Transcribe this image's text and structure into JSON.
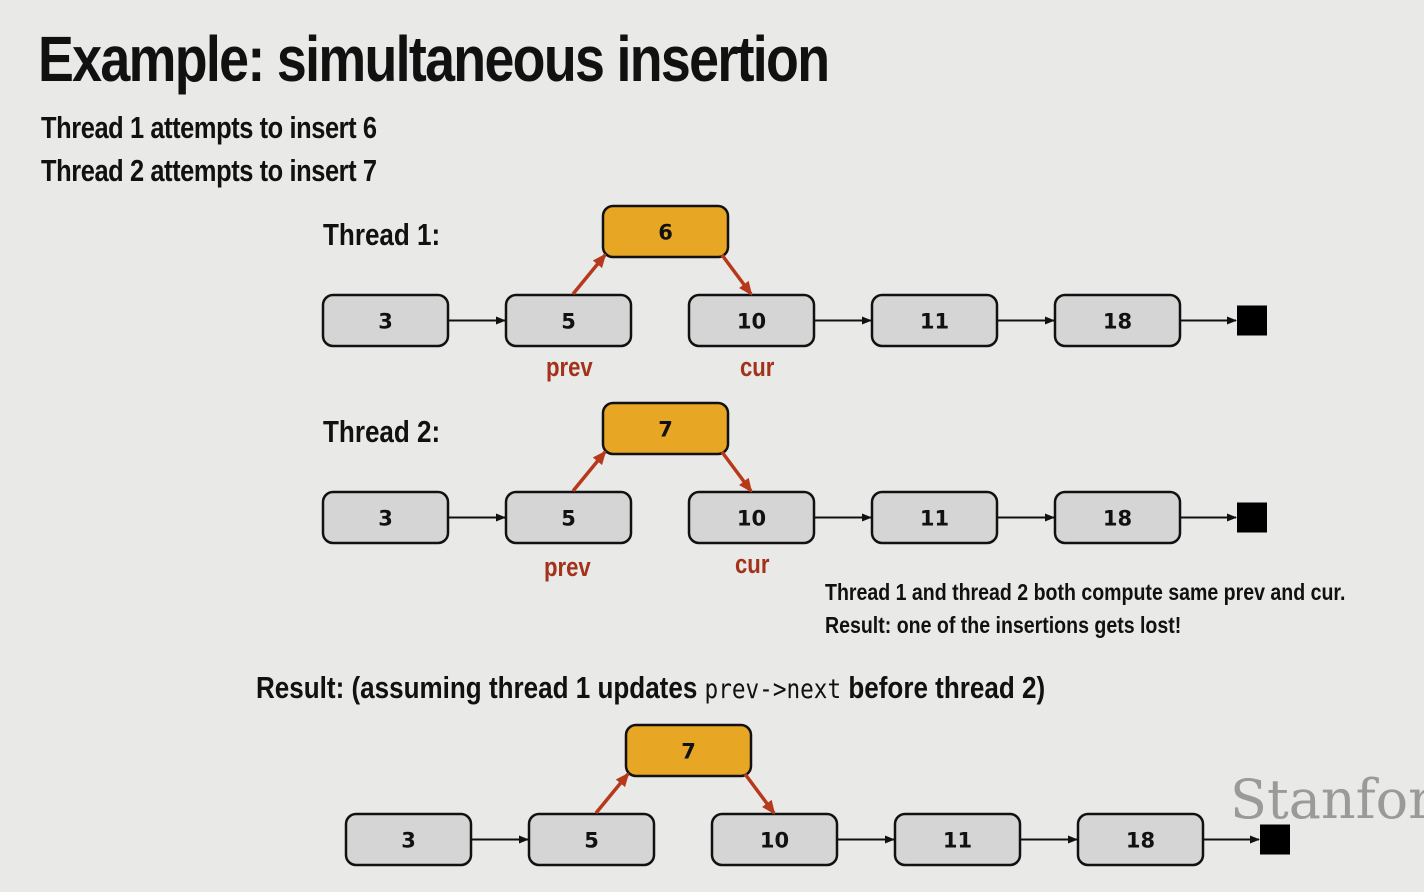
{
  "slide": {
    "title": "Example: simultaneous insertion",
    "lines": [
      "Thread 1 attempts to insert 6",
      "Thread 2 attempts to insert 7"
    ],
    "thread1_label": "Thread 1:",
    "thread2_label": "Thread 2:",
    "note_lines": [
      "Thread 1 and thread 2 both compute same prev and cur.",
      "Result: one of the insertions gets lost!"
    ],
    "result": {
      "prefix": "Result: (assuming thread 1 updates ",
      "code": "prev->next",
      "suffix": " before thread 2)"
    },
    "watermark": "Stanford"
  },
  "diagrams": [
    {
      "name": "thread1",
      "list": [
        "3",
        "5",
        "10",
        "11",
        "18"
      ],
      "inserted": "6",
      "prev_label": "prev",
      "cur_label": "cur"
    },
    {
      "name": "thread2",
      "list": [
        "3",
        "5",
        "10",
        "11",
        "18"
      ],
      "inserted": "7",
      "prev_label": "prev",
      "cur_label": "cur"
    },
    {
      "name": "result",
      "list": [
        "3",
        "5",
        "10",
        "11",
        "18"
      ],
      "inserted": "7"
    }
  ],
  "colors": {
    "node_fill": "#d5d5d5",
    "inserted_fill": "#e7a623",
    "pointer_arrow": "#b7391c",
    "pointer_text": "#a2321a"
  }
}
